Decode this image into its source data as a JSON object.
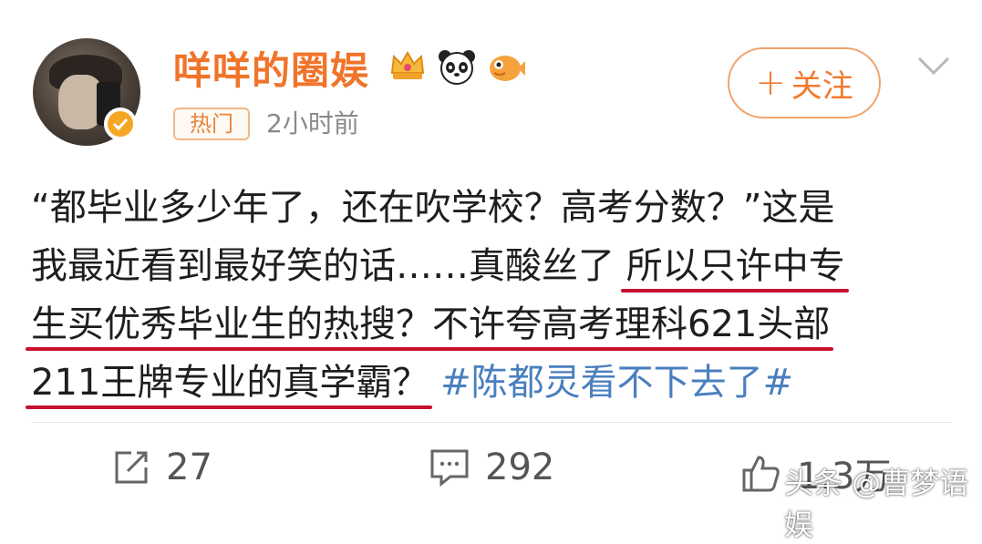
{
  "author": {
    "name": "咩咩的圈娱",
    "hot_tag": "热门",
    "time": "2小时前"
  },
  "header": {
    "follow_label": "关注",
    "follow_plus": "+"
  },
  "post": {
    "line1": "“都毕业多少年了，还在吹学校？高考分数？”这是",
    "line2_plain": "我最近看到最好笑的话……真酸丝了 ",
    "line2_highlight": "所以只许中专",
    "line3_highlight": "生买优秀毕业生的热搜？不许夸高考理科621头部",
    "line4_highlight": "211王牌专业的真学霸？",
    "line4_hashtag": "#陈都灵看不下去了#"
  },
  "actions": {
    "repost_count": "27",
    "comment_count": "292",
    "like_count": "1.3万"
  },
  "watermark": "头条 @曹梦语娱",
  "colors": {
    "brand_orange": "#f0742a",
    "hashtag_blue": "#4a7fbf",
    "underline_red": "#c8102e"
  }
}
